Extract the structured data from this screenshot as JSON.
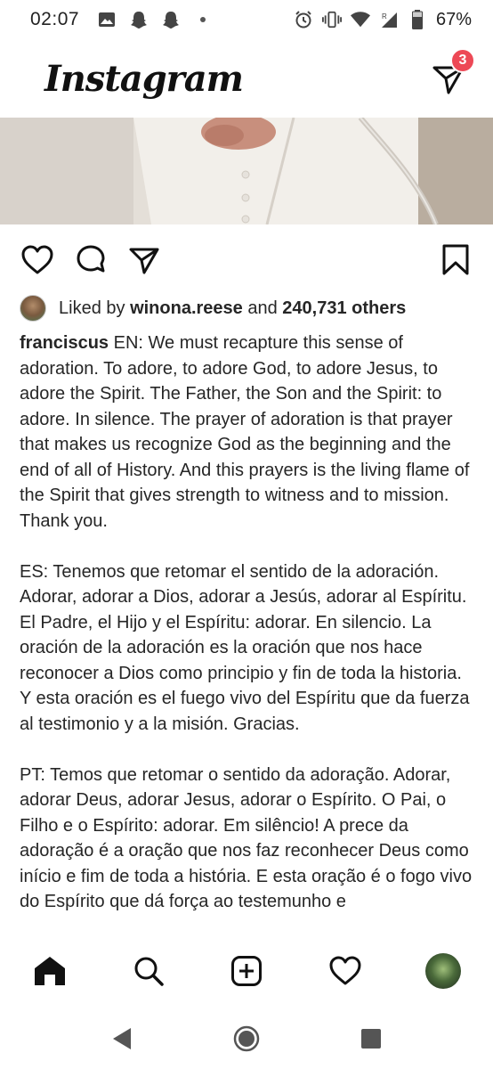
{
  "status_bar": {
    "time": "02:07",
    "battery": "67%",
    "left_icons": [
      "image-icon",
      "snapchat-icon",
      "snapchat-icon",
      "dot-icon"
    ],
    "right_icons": [
      "alarm-icon",
      "vibrate-icon",
      "wifi-icon",
      "signal-icon",
      "battery-icon"
    ]
  },
  "header": {
    "logo_text": "Instagram",
    "dm_badge_count": "3"
  },
  "post": {
    "likes": {
      "prefix": "Liked by",
      "liker": "winona.reese",
      "middle": "and",
      "others": "240,731 others"
    },
    "caption": {
      "username": "franciscus",
      "paragraph_en": "EN: We must recapture this sense of adoration. To adore, to adore God, to adore Jesus, to adore the Spirit. The Father, the Son and the Spirit: to adore. In silence. The prayer of adoration is that prayer that makes us recognize God as the beginning and the end of all of History. And this prayers is the living flame of the Spirit that gives strength to witness and to mission. Thank you.",
      "paragraph_es": "ES: Tenemos que retomar el sentido de la adoración. Adorar, adorar a Dios, adorar a Jesús, adorar al Espíritu. El Padre, el Hijo y el Espíritu: adorar. En silencio. La oración de la adoración es la oración que nos hace reconocer a Dios como principio y fin de toda la historia. Y esta oración es el fuego vivo del Espíritu que da fuerza al testimonio y a la misión. Gracias.",
      "paragraph_pt": "PT: Temos que retomar o sentido da adoração. Adorar, adorar Deus, adorar Jesus, adorar o Espírito. O Pai, o Filho e o Espírito: adorar. Em silêncio! A prece da adoração é a oração que nos faz reconhecer Deus como início e fim de toda a história. E esta oração é o fogo vivo do Espírito que dá força ao testemunho e"
    }
  },
  "bottom_nav": [
    "home-icon",
    "search-icon",
    "add-post-icon",
    "activity-heart-icon",
    "profile-avatar"
  ],
  "system_nav": [
    "back-icon",
    "home-circle-icon",
    "recents-icon"
  ],
  "colors": {
    "badge": "#ed4956",
    "text": "#262626"
  }
}
